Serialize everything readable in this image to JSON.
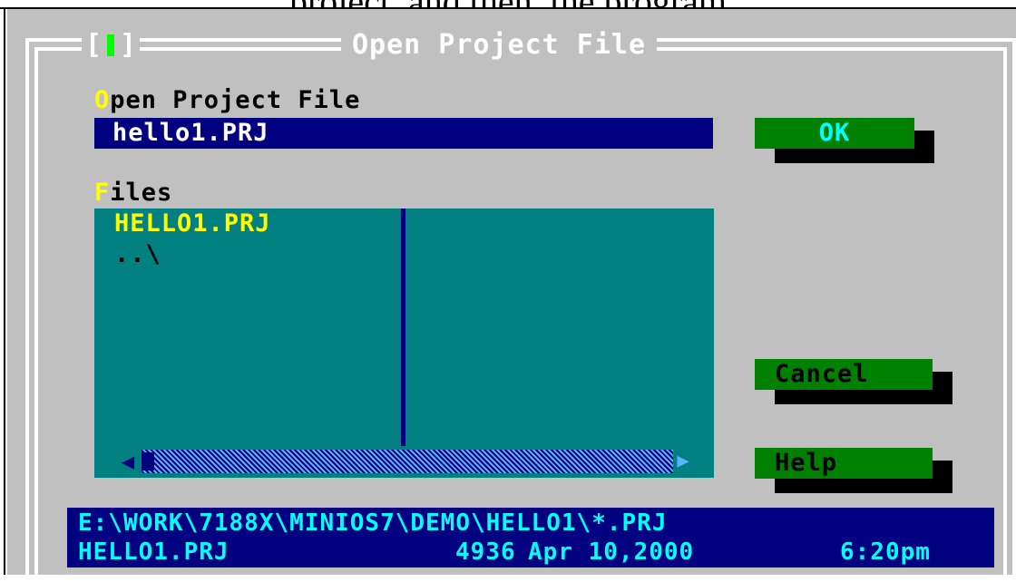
{
  "page": {
    "caption_fragment": "project, and then, the program"
  },
  "dialog": {
    "title": "Open Project File",
    "close_open": "[",
    "close_close": "]",
    "open_label_hotkey": "O",
    "open_label_rest": "pen Project File",
    "filename_value": "hello1.PRJ",
    "files_label_hotkey": "F",
    "files_label_rest": "iles",
    "files": [
      "HELLO1.PRJ",
      "..\\"
    ],
    "buttons": {
      "ok": "OK",
      "cancel": "Cancel",
      "help": "Help"
    },
    "status": {
      "path": "E:\\WORK\\7188X\\MINIOS7\\DEMO\\HELLO1\\*.PRJ",
      "file": "HELLO1.PRJ",
      "size": "4936",
      "date": "Apr 10,2000",
      "time": "6:20pm"
    }
  },
  "colors": {
    "dialog_bg": "#c0c0c0",
    "input_bg": "#000080",
    "list_bg": "#008080",
    "button_bg": "#008000",
    "hotkey": "#ffff00",
    "status_text": "#00ffff"
  },
  "icons": [
    "close-icon",
    "scroll-left-arrow-icon",
    "scroll-right-arrow-icon"
  ]
}
